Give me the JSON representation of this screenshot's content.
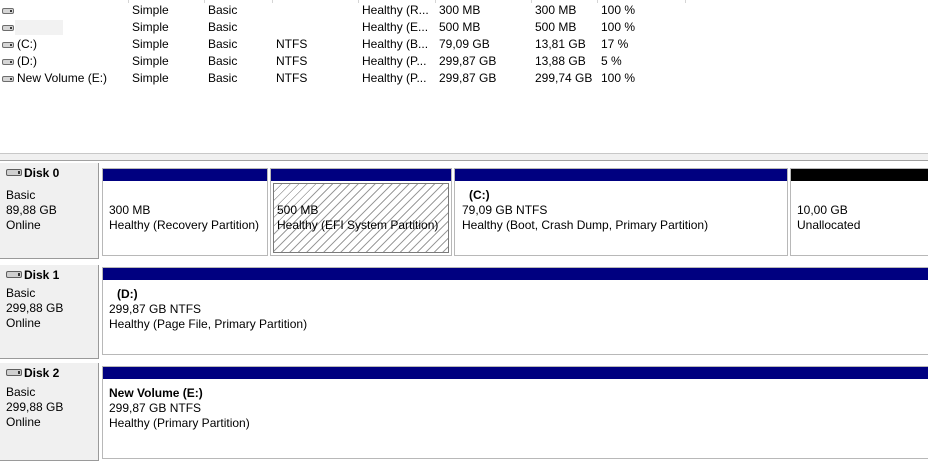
{
  "volumes": [
    {
      "name": "",
      "layout": "Simple",
      "type": "Basic",
      "fs": "",
      "status": "Healthy (R...",
      "capacity": "300 MB",
      "free": "300 MB",
      "pct": "100 %"
    },
    {
      "name": "",
      "layout": "Simple",
      "type": "Basic",
      "fs": "",
      "status": "Healthy (E...",
      "capacity": "500 MB",
      "free": "500 MB",
      "pct": "100 %"
    },
    {
      "name": "(C:)",
      "layout": "Simple",
      "type": "Basic",
      "fs": "NTFS",
      "status": "Healthy (B...",
      "capacity": "79,09 GB",
      "free": "13,81 GB",
      "pct": "17 %"
    },
    {
      "name": "(D:)",
      "layout": "Simple",
      "type": "Basic",
      "fs": "NTFS",
      "status": "Healthy (P...",
      "capacity": "299,87 GB",
      "free": "13,88 GB",
      "pct": "5 %"
    },
    {
      "name": "New Volume (E:)",
      "layout": "Simple",
      "type": "Basic",
      "fs": "NTFS",
      "status": "Healthy (P...",
      "capacity": "299,87 GB",
      "free": "299,74 GB",
      "pct": "100 %"
    }
  ],
  "disks": [
    {
      "title": "Disk 0",
      "type": "Basic",
      "size": "89,88 GB",
      "state": "Online",
      "partitions": [
        {
          "label": "",
          "size": "300 MB",
          "status": "Healthy (Recovery Partition)"
        },
        {
          "label": "",
          "size": "500 MB",
          "status": "Healthy (EFI System Partition)"
        },
        {
          "label": "(C:)",
          "size": "79,09 GB NTFS",
          "status": "Healthy (Boot, Crash Dump, Primary Partition)"
        },
        {
          "label": "",
          "size": "10,00 GB",
          "status": "Unallocated"
        }
      ]
    },
    {
      "title": "Disk 1",
      "type": "Basic",
      "size": "299,88 GB",
      "state": "Online",
      "partitions": [
        {
          "label": "(D:)",
          "size": "299,87 GB NTFS",
          "status": "Healthy (Page File, Primary Partition)"
        }
      ]
    },
    {
      "title": "Disk 2",
      "type": "Basic",
      "size": "299,88 GB",
      "state": "Online",
      "partitions": [
        {
          "label": "New Volume  (E:)",
          "size": "299,87 GB NTFS",
          "status": "Healthy (Primary Partition)"
        }
      ]
    }
  ],
  "colors": {
    "primary_partition_bar": "#000080",
    "unallocated_bar": "#000000",
    "panel_background": "#f0f0f0"
  }
}
